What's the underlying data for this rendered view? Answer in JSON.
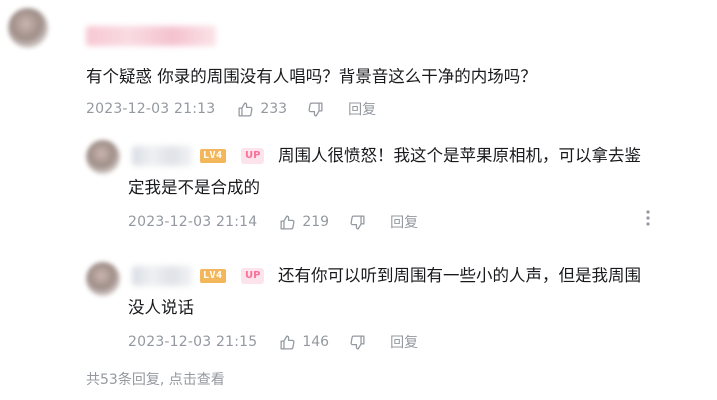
{
  "top_comment": {
    "text": "有个疑惑 你录的周围没有人唱吗？背景音这么干净的内场吗？",
    "time": "2023-12-03 21:13",
    "likes": "233",
    "reply_label": "回复"
  },
  "replies": [
    {
      "level": "LV4",
      "badge": "UP",
      "text_line1": "周围人很愤怒！我这个是苹果原相机，可以拿去鉴",
      "text_line2": "定我是不是合成的",
      "time": "2023-12-03 21:14",
      "likes": "219",
      "reply_label": "回复",
      "more_icon": "more-vertical-icon"
    },
    {
      "level": "LV4",
      "badge": "UP",
      "text_line1": "还有你可以听到周围有一些小的人声，但是我周围",
      "text_line2": "没人说话",
      "time": "2023-12-03 21:15",
      "likes": "146",
      "reply_label": "回复"
    }
  ],
  "footer": {
    "replies_summary": "共53条回复, 点击查看"
  },
  "colors": {
    "muted": "#9499a0",
    "text": "#18191c",
    "up_pink": "#fb7299",
    "level_orange": "#f3b65b"
  }
}
